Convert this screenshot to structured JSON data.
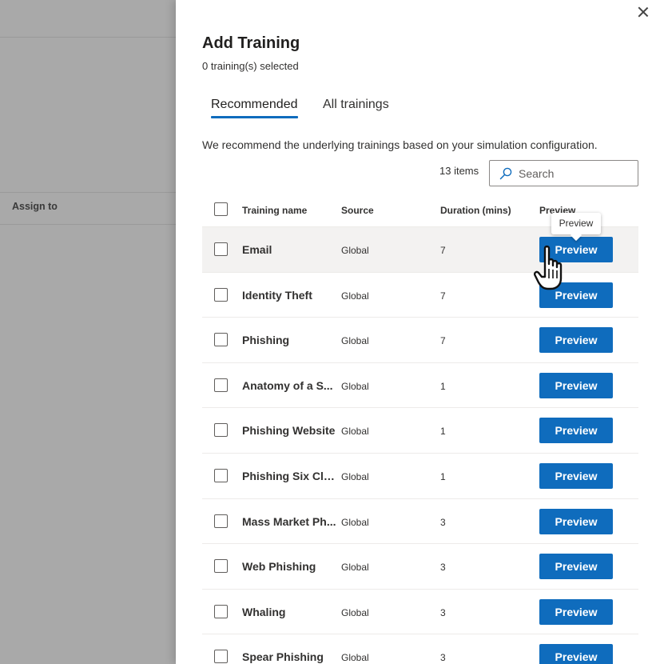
{
  "background": {
    "assign_to_label": "Assign to"
  },
  "panel": {
    "title": "Add Training",
    "subtitle": "0 training(s) selected",
    "close_icon": "close-icon",
    "tabs": [
      {
        "label": "Recommended",
        "selected": true
      },
      {
        "label": "All trainings",
        "selected": false
      }
    ],
    "recommend_text": "We recommend the underlying trainings based on your simulation configuration.",
    "items_count": "13 items",
    "search": {
      "placeholder": "Search",
      "value": "",
      "icon": "search-icon"
    },
    "accent_color": "#0f6cbd"
  },
  "table": {
    "headers": {
      "name": "Training name",
      "source": "Source",
      "duration": "Duration (mins)",
      "preview": "Preview"
    },
    "rows": [
      {
        "name": "Email",
        "source": "Global",
        "duration": "7",
        "preview_label": "Preview"
      },
      {
        "name": "Identity Theft",
        "source": "Global",
        "duration": "7",
        "preview_label": "Preview"
      },
      {
        "name": "Phishing",
        "source": "Global",
        "duration": "7",
        "preview_label": "Preview"
      },
      {
        "name": "Anatomy of a S...",
        "source": "Global",
        "duration": "1",
        "preview_label": "Preview"
      },
      {
        "name": "Phishing Website",
        "source": "Global",
        "duration": "1",
        "preview_label": "Preview"
      },
      {
        "name": "Phishing Six Clu...",
        "source": "Global",
        "duration": "1",
        "preview_label": "Preview"
      },
      {
        "name": "Mass Market Ph...",
        "source": "Global",
        "duration": "3",
        "preview_label": "Preview"
      },
      {
        "name": "Web Phishing",
        "source": "Global",
        "duration": "3",
        "preview_label": "Preview"
      },
      {
        "name": "Whaling",
        "source": "Global",
        "duration": "3",
        "preview_label": "Preview"
      },
      {
        "name": "Spear Phishing",
        "source": "Global",
        "duration": "3",
        "preview_label": "Preview"
      }
    ]
  },
  "tooltip": {
    "text": "Preview"
  }
}
